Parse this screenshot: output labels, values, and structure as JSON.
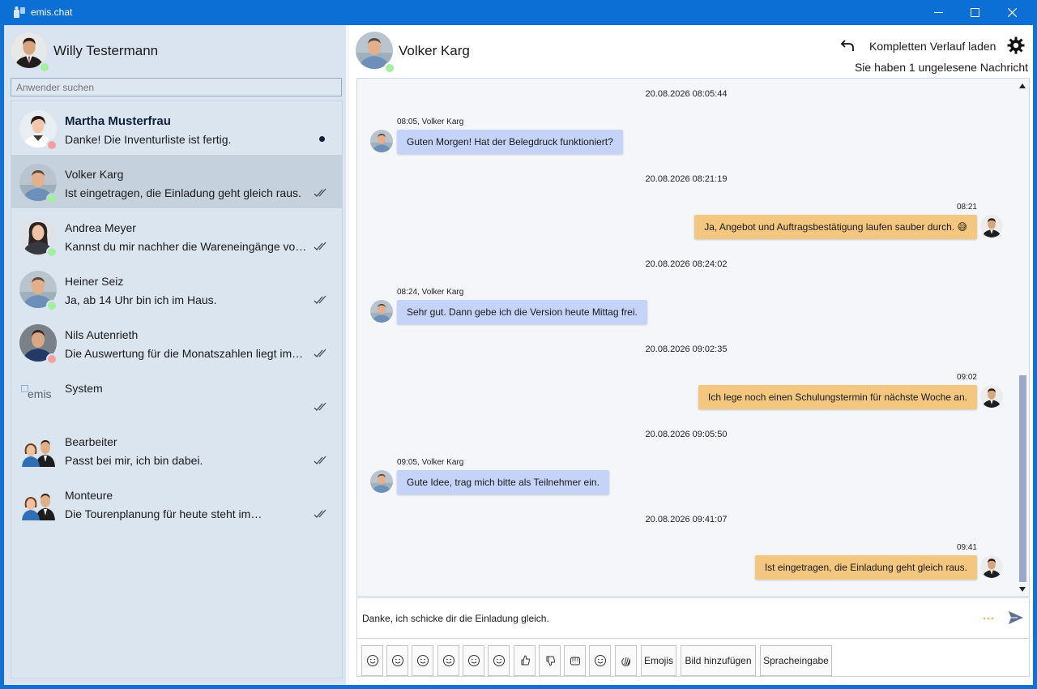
{
  "app": {
    "title": "emis.chat"
  },
  "me": {
    "name": "Willy Testermann",
    "status": "online"
  },
  "search": {
    "placeholder": "Anwender suchen"
  },
  "contacts": [
    {
      "name": "Martha Musterfrau",
      "message": "Danke! Die Inventurliste ist fertig.",
      "status": "offline",
      "unread": true,
      "bold": true
    },
    {
      "name": "Volker Karg",
      "message": "Ist eingetragen, die Einladung geht gleich raus.",
      "status": "online",
      "selected": true,
      "read": true
    },
    {
      "name": "Andrea Meyer",
      "message": "Kannst du mir nachher die Wareneingänge von…",
      "status": "online",
      "read": true
    },
    {
      "name": "Heiner Seiz",
      "message": "Ja, ab 14 Uhr bin ich im Haus.",
      "status": "online",
      "read": true
    },
    {
      "name": "Nils Autenrieth",
      "message": "Die Auswertung für die Monatszahlen liegt im…",
      "status": "offline",
      "read": true
    },
    {
      "name": "System",
      "message": "",
      "logo_text": "emis",
      "read": true
    },
    {
      "name": "Bearbeiter",
      "message": "Passt bei mir, ich bin dabei.",
      "read": true
    },
    {
      "name": "Monteure",
      "message": "Die Tourenplanung für heute steht im…",
      "read": true
    }
  ],
  "conversation": {
    "peer_name": "Volker Karg",
    "peer_status": "online",
    "load_history_label": "Kompletten Verlauf laden",
    "unread_note": "Sie haben 1 ungelesene Nachricht",
    "messages": [
      {
        "date": "20.08.2026 08:05:44",
        "meta": "08:05, Volker Karg",
        "text": "Guten Morgen! Hat der Belegdruck funktioniert?",
        "outgoing": false
      },
      {
        "date": "20.08.2026 08:21:19",
        "meta": "08:21",
        "text": "Ja, Angebot und Auftragsbestätigung laufen sauber durch. 😅",
        "outgoing": true
      },
      {
        "date": "20.08.2026 08:24:02",
        "meta": "08:24, Volker Karg",
        "text": "Sehr gut. Dann gebe ich die Version heute Mittag frei.",
        "outgoing": false
      },
      {
        "date": "20.08.2026 09:02:35",
        "meta": "09:02",
        "text": "Ich lege noch einen Schulungstermin für nächste Woche an.",
        "outgoing": true
      },
      {
        "date": "20.08.2026 09:05:50",
        "meta": "09:05, Volker Karg",
        "text": "Gute Idee, trag mich bitte als Teilnehmer ein.",
        "outgoing": false
      },
      {
        "date": "20.08.2026 09:41:07",
        "meta": "09:41",
        "text": "Ist eingetragen, die Einladung geht gleich raus.",
        "outgoing": true
      }
    ]
  },
  "composer": {
    "value": "Danke, ich schicke dir die Einladung gleich.",
    "emoji_buttons": [
      "grinning-face-icon",
      "winking-face-icon",
      "laughing-face-icon",
      "screaming-face-icon",
      "sweat-smile-face-icon",
      "dizzy-face-icon",
      "thumbs-up-icon",
      "thumbs-down-icon",
      "fist-icon",
      "tongue-face-icon",
      "waving-hand-icon"
    ],
    "emojis_label": "Emojis",
    "add_image_label": "Bild hinzufügen",
    "voice_label": "Spracheingabe"
  },
  "colors": {
    "titlebar": "#0b6fd6",
    "sidebar": "#d9e4f0",
    "selected": "#c6d1de",
    "incoming_bubble": "#c4d3f7",
    "outgoing_bubble": "#f3c77f",
    "online": "#a3ef9f",
    "offline": "#f4a0a0"
  }
}
